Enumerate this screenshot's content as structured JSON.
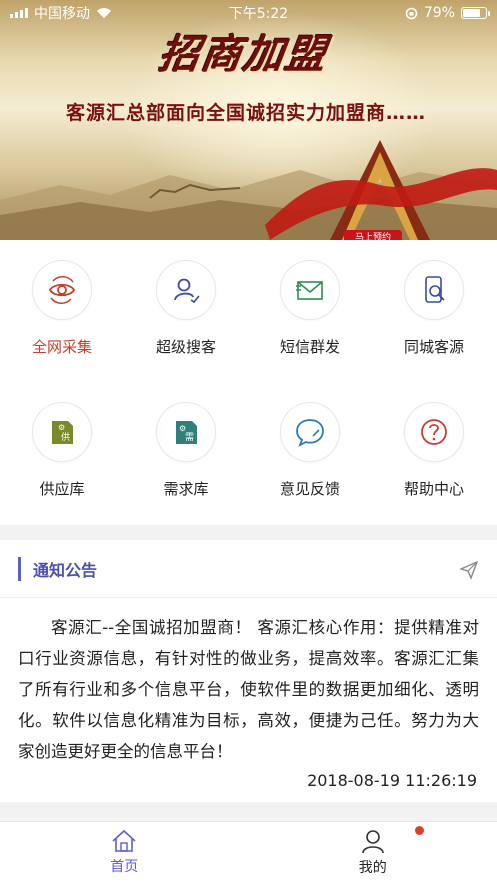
{
  "status_bar": {
    "carrier": "中国移动",
    "time": "下午5:22",
    "battery": "79%",
    "battery_level": 0.79
  },
  "banner": {
    "title": "招商加盟",
    "subtitle": "客源汇总部面向全国诚招实力加盟商……",
    "button": "马上预约"
  },
  "grid": {
    "items": [
      {
        "label": "全网采集",
        "icon": "eye-sync-icon",
        "active": true
      },
      {
        "label": "超级搜客",
        "icon": "user-search-icon"
      },
      {
        "label": "短信群发",
        "icon": "envelope-icon"
      },
      {
        "label": "同城客源",
        "icon": "phone-search-icon"
      },
      {
        "label": "供应库",
        "icon": "supply-icon",
        "badge": "供"
      },
      {
        "label": "需求库",
        "icon": "demand-icon",
        "badge": "需"
      },
      {
        "label": "意见反馈",
        "icon": "chat-feedback-icon"
      },
      {
        "label": "帮助中心",
        "icon": "question-icon"
      }
    ]
  },
  "notice": {
    "title": "通知公告",
    "content": "客源汇--全国诚招加盟商！ 客源汇核心作用：提供精准对口行业资源信息，有针对性的做业务，提高效率。客源汇汇集了所有行业和多个信息平台，使软件里的数据更加细化、透明化。软件以信息化精准为目标，高效，便捷为己任。努力为大家创造更好更全的信息平台！",
    "time": "2018-08-19 11:26:19"
  },
  "tabbar": {
    "home": "首页",
    "mine": "我的"
  },
  "colors": {
    "accent": "#5b5fc7",
    "active_red": "#c4402b",
    "badge_red": "#e53b2c",
    "olive": "#7a8a2a",
    "teal": "#2f7f7a"
  }
}
